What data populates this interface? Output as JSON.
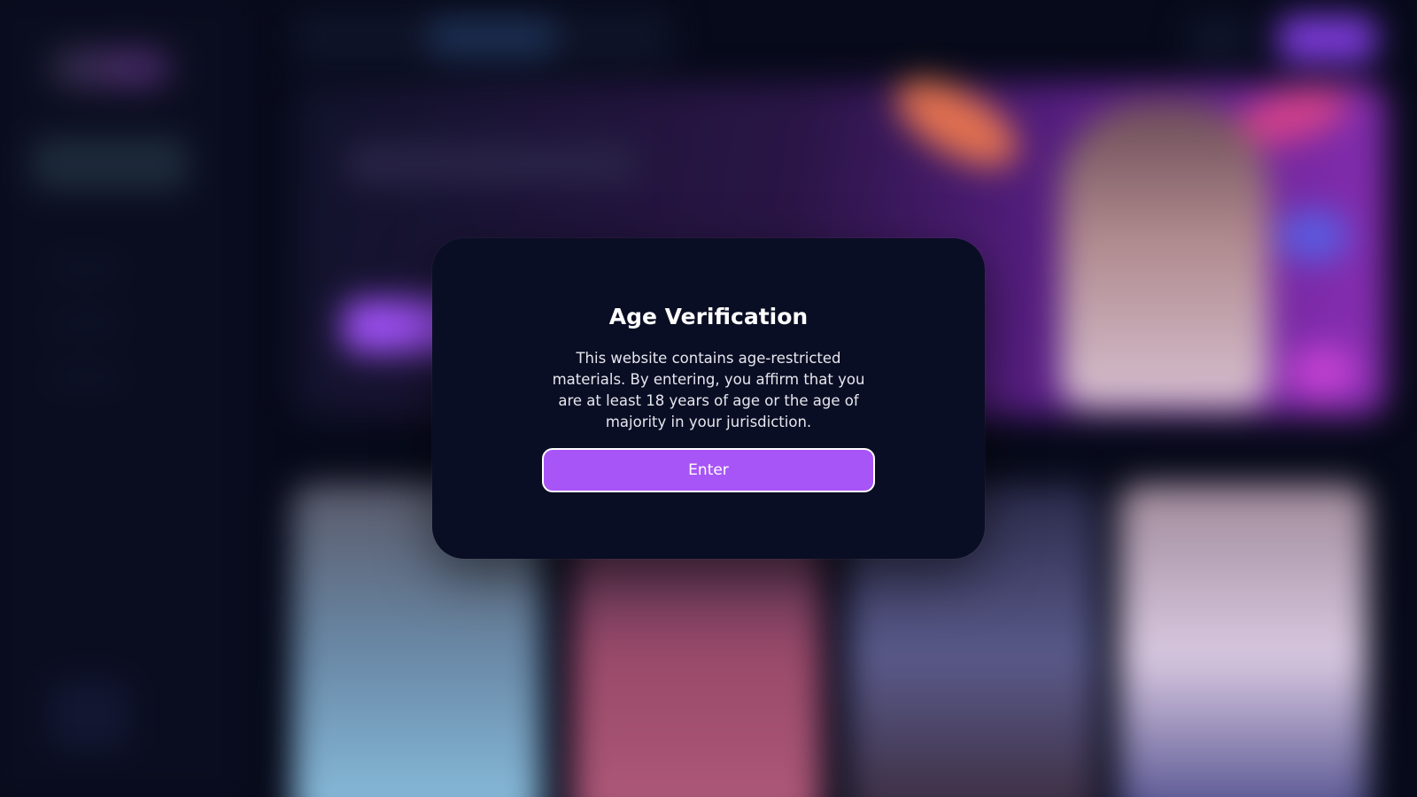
{
  "modal": {
    "title": "Age Verification",
    "message": "This website contains age-restricted materials. By entering, you affirm that you are at least 18 years of age or the age of majority in your jurisdiction.",
    "enter_label": "Enter"
  },
  "colors": {
    "overlay_backdrop": "#070a1a",
    "modal_background": "#0a0e24",
    "accent": "#a855f7",
    "text": "#ffffff"
  }
}
